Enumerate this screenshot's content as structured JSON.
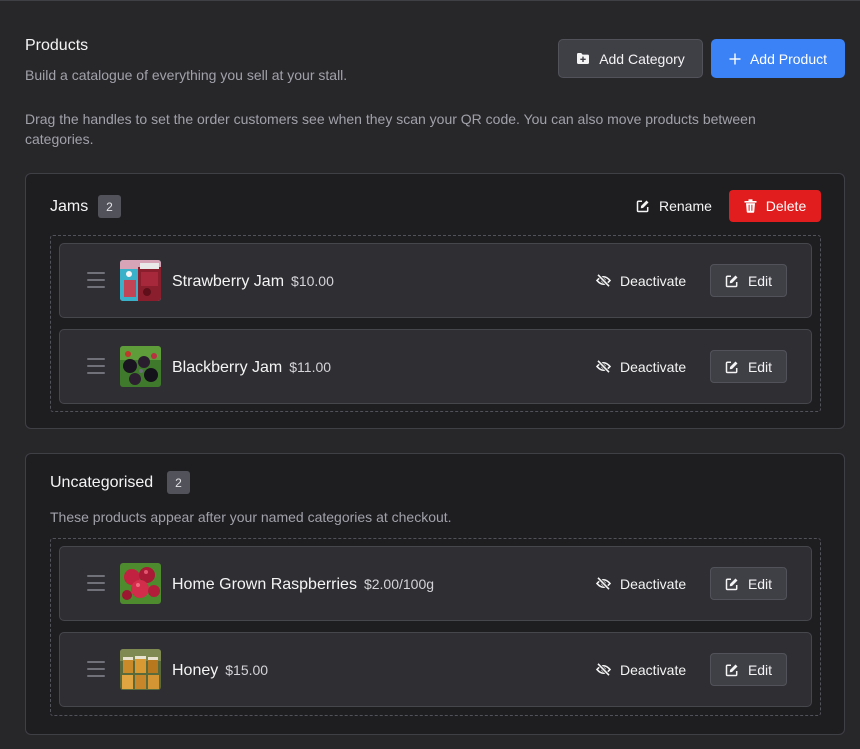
{
  "header": {
    "title": "Products",
    "subtitle": "Build a catalogue of everything you sell at your stall.",
    "instructions": "Drag the handles to set the order customers see when they scan your QR code. You can also move products between categories.",
    "add_category_label": "Add Category",
    "add_product_label": "Add Product"
  },
  "categories": [
    {
      "name": "Jams",
      "count": "2",
      "rename_label": "Rename",
      "delete_label": "Delete",
      "products": [
        {
          "name": "Strawberry Jam",
          "price": "$10.00",
          "thumb": "strawberry-jam-thumbnail",
          "deactivate_label": "Deactivate",
          "edit_label": "Edit"
        },
        {
          "name": "Blackberry Jam",
          "price": "$11.00",
          "thumb": "blackberry-jam-thumbnail",
          "deactivate_label": "Deactivate",
          "edit_label": "Edit"
        }
      ]
    },
    {
      "name": "Uncategorised",
      "count": "2",
      "description": "These products appear after your named categories at checkout.",
      "products": [
        {
          "name": "Home Grown Raspberries",
          "price": "$2.00/100g",
          "thumb": "raspberries-thumbnail",
          "deactivate_label": "Deactivate",
          "edit_label": "Edit"
        },
        {
          "name": "Honey",
          "price": "$15.00",
          "thumb": "honey-thumbnail",
          "deactivate_label": "Deactivate",
          "edit_label": "Edit"
        }
      ]
    }
  ],
  "colors": {
    "background": "#27272a",
    "card": "#1e1e21",
    "row": "#2f2f33",
    "primary": "#3b82f6",
    "danger": "#e11d1d"
  },
  "icons": {
    "add_category": "folder-plus-icon",
    "add_product": "plus-icon",
    "rename": "edit-icon",
    "delete": "trash-icon",
    "deactivate": "eye-off-icon",
    "edit": "edit-icon",
    "drag": "drag-handle-icon"
  }
}
